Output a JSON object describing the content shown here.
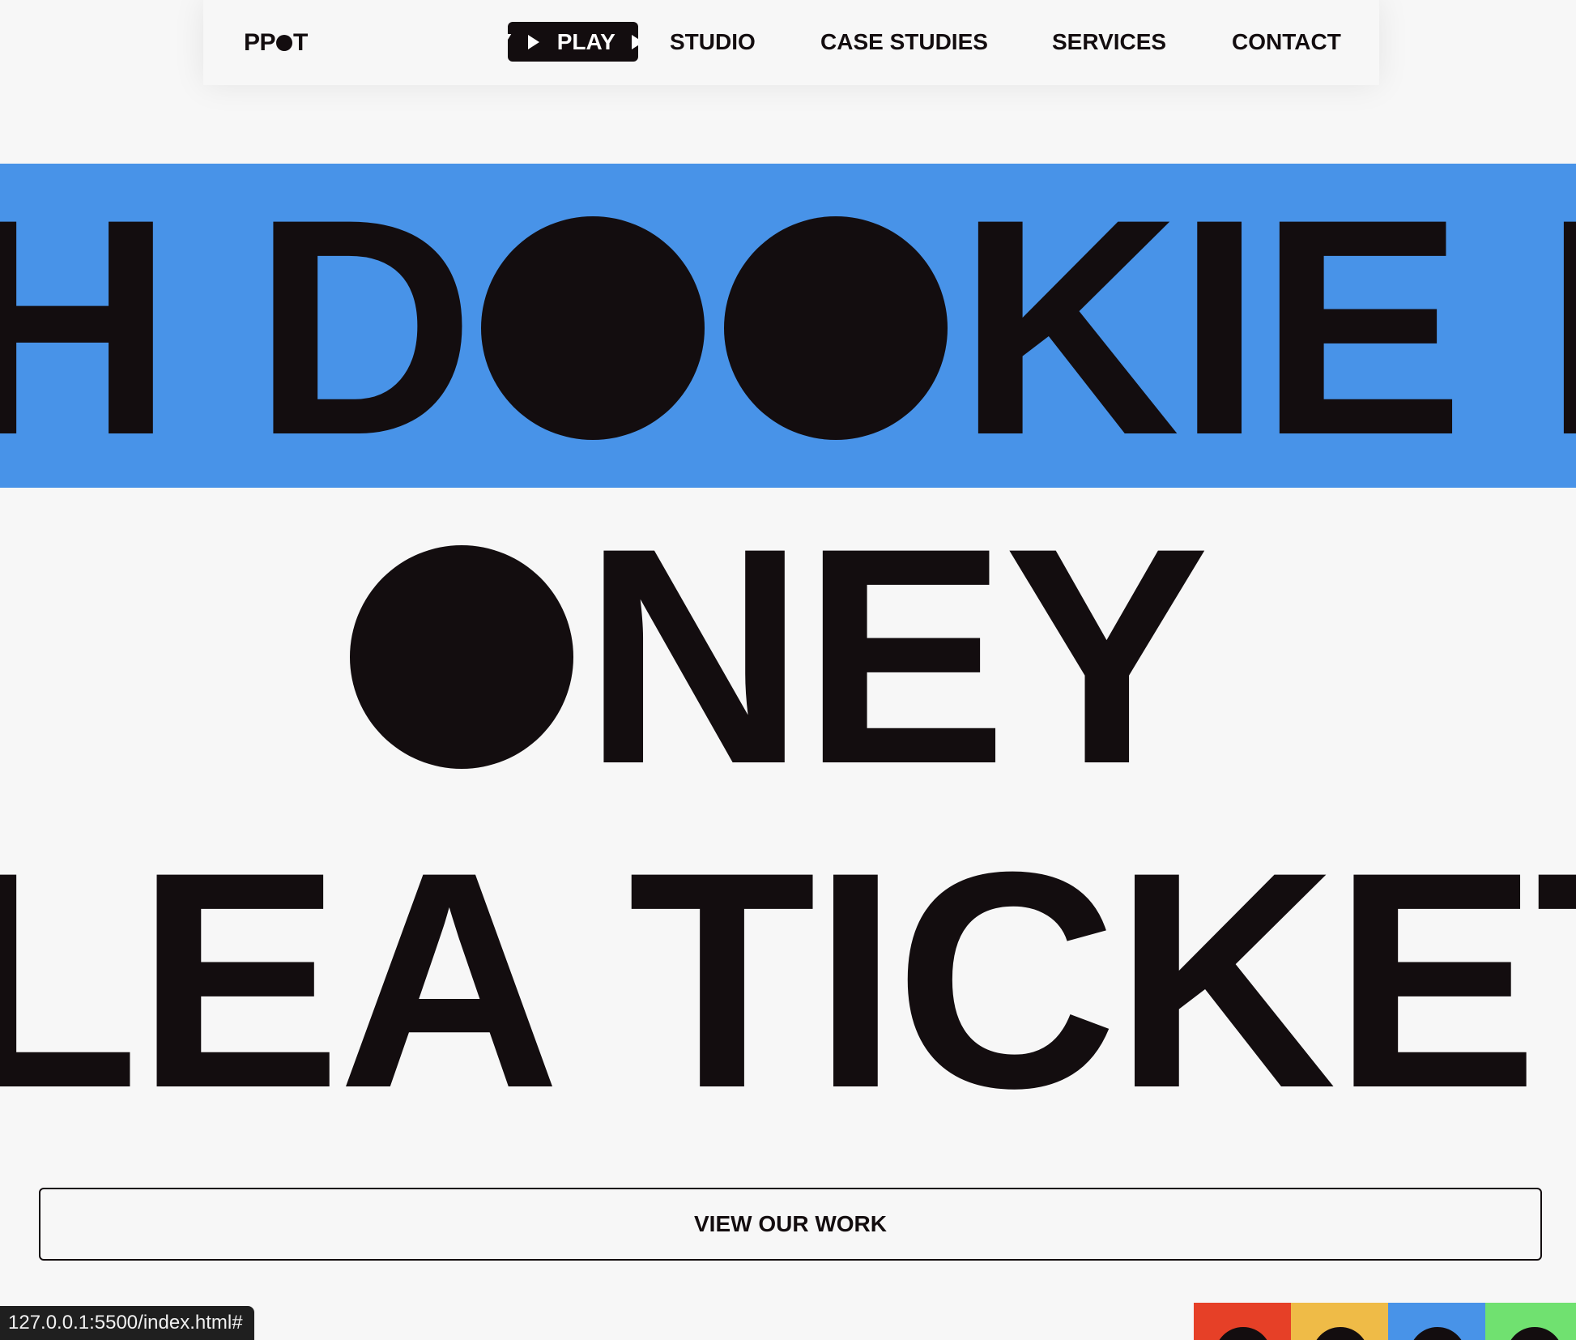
{
  "colors": {
    "background": "#f7f7f7",
    "ink": "#130d0f",
    "blue_band": "#4893e8",
    "swatch_red": "#e64027",
    "swatch_yellow": "#efbb47",
    "swatch_blue": "#4893e8",
    "swatch_green": "#70e170"
  },
  "nav": {
    "logo": {
      "pre": "PP",
      "post": "T"
    },
    "play": {
      "word_left": "Y",
      "word_right": "PLAY"
    },
    "links": {
      "studio": "STUDIO",
      "case_studies": "CASE STUDIES",
      "services": "SERVICES",
      "contact": "CONTACT"
    }
  },
  "hero": {
    "line1": {
      "before": "H D",
      "after": "KIE I"
    },
    "line2": {
      "after": "NEY"
    },
    "line3": {
      "text": "LEA TICKET"
    }
  },
  "cta": {
    "label": "VIEW OUR WORK"
  },
  "status_bar": {
    "url": "127.0.0.1:5500/index.html#"
  },
  "swatches": [
    {
      "color_key": "swatch_red"
    },
    {
      "color_key": "swatch_yellow"
    },
    {
      "color_key": "swatch_blue"
    },
    {
      "color_key": "swatch_green"
    }
  ]
}
